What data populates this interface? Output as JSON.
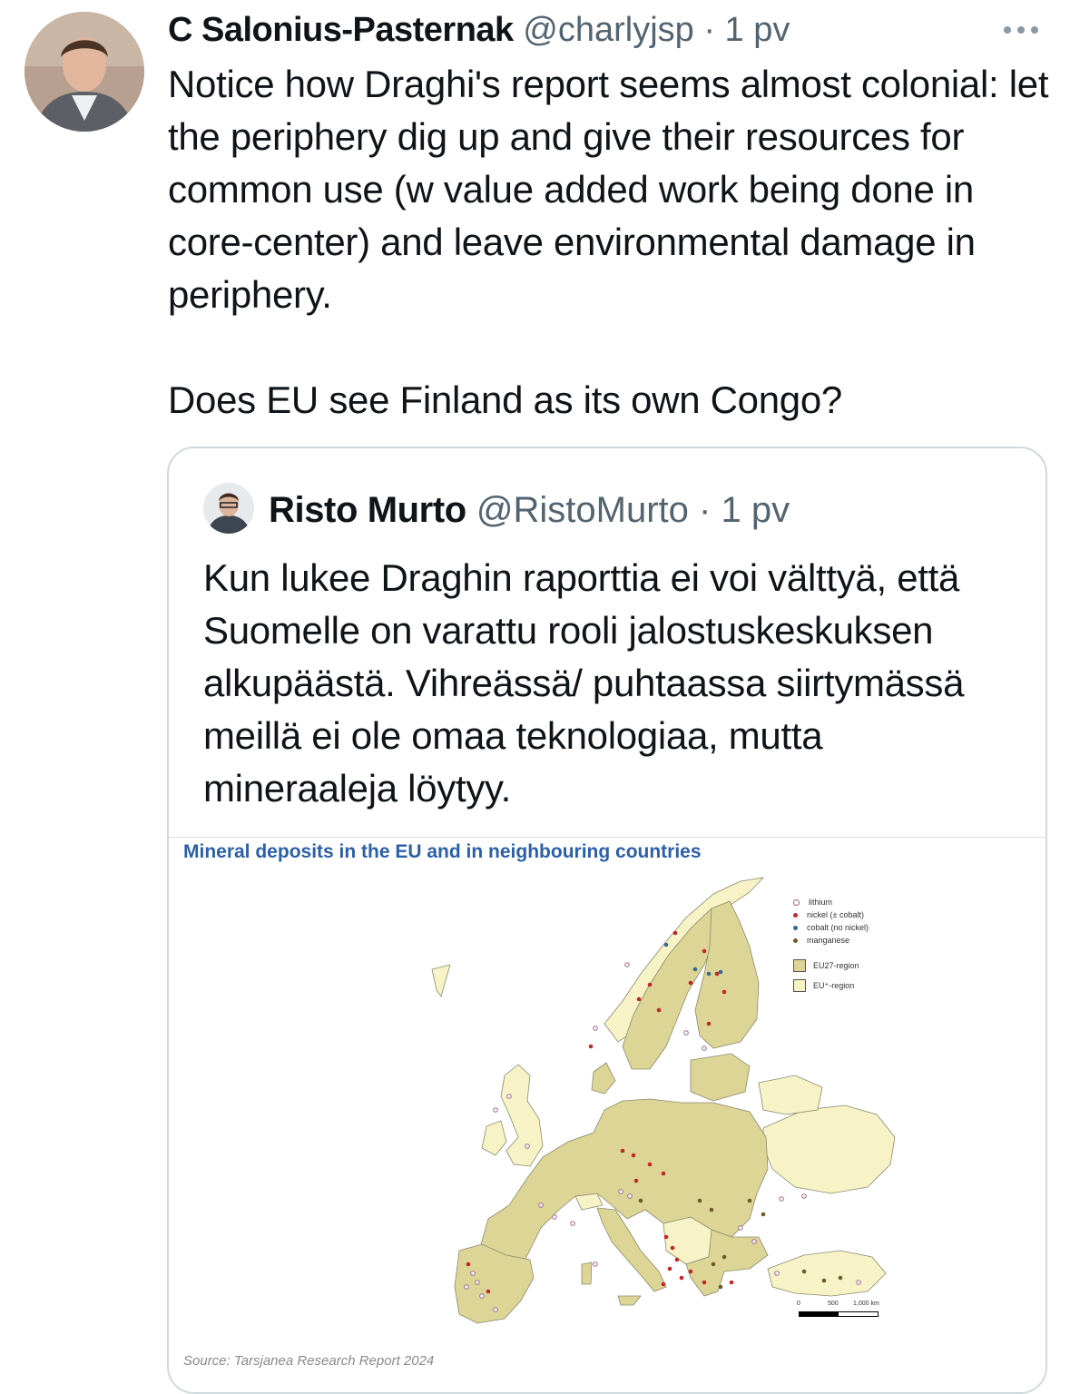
{
  "tweet": {
    "author_name": "C Salonius-Pasternak",
    "author_handle": "@charlyjsp",
    "separator": "·",
    "time": "1 pv",
    "text": "Notice how Draghi's report seems almost colonial: let the periphery dig up and give their resources for common use (w value added work being done in core-center) and leave environmental damage in periphery.\n\nDoes EU see Finland as its own Congo?"
  },
  "quoted": {
    "author_name": "Risto Murto",
    "author_handle": "@RistoMurto",
    "separator": "·",
    "time": "1 pv",
    "text": "Kun lukee Draghin raporttia ei voi välttyä, että Suomelle on varattu rooli jalostuskeskuksen alkupäästä. Vihreässä/ puhtaassa siirtymässä meillä ei ole omaa teknologiaa, mutta mineraaleja löytyy.",
    "image": {
      "title": "Mineral deposits in the EU and in neighbouring countries",
      "legend": [
        {
          "label": "lithium",
          "color": "#ffffff",
          "border": "#a0648c"
        },
        {
          "label": "nickel (± cobalt)",
          "color": "#c0282a",
          "border": "#c0282a"
        },
        {
          "label": "cobalt (no nickel)",
          "color": "#2f6c8f",
          "border": "#2f6c8f"
        },
        {
          "label": "manganese",
          "color": "#6e5a2a",
          "border": "#6e5a2a"
        }
      ],
      "regions": [
        {
          "label": "EU27-region",
          "color": "#ddd596"
        },
        {
          "label": "EU⁺-region",
          "color": "#f7f3c6"
        }
      ],
      "scale": {
        "zero": "0",
        "mid": "500",
        "end": "1,000 km"
      },
      "source": "Source: Tarsjanea Research Report 2024"
    }
  },
  "colors": {
    "text": "#0f1419",
    "muted": "#536471",
    "border": "#cfd9de",
    "map_title": "#2b5fa8"
  },
  "icons": {
    "more": "more-horizontal-icon"
  }
}
